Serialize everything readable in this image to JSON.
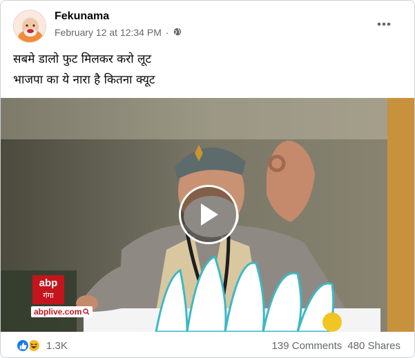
{
  "post": {
    "author": "Fekunama",
    "timestamp": "February 12 at 12:34 PM",
    "separator": "·",
    "privacy_icon": "globe-icon",
    "more_icon": "more-options-icon",
    "caption_lines": [
      "सबमे डालो फुट मिलकर करो लूट",
      "भाजपा का ये नारा है कितना क्यूट"
    ]
  },
  "video": {
    "play_icon": "play-icon",
    "channel_badge_top": "abp",
    "channel_badge_bottom": "गंगा",
    "channel_url": "abplive.com"
  },
  "engagement": {
    "reaction_icons": [
      "like-icon",
      "haha-icon"
    ],
    "reaction_count": "1.3K",
    "comments": "139 Comments",
    "shares": "480 Shares"
  },
  "colors": {
    "brand_blue": "#1877f2",
    "haha_yellow": "#f7b928",
    "abp_red": "#c4151c",
    "secondary_text": "#65676b"
  }
}
